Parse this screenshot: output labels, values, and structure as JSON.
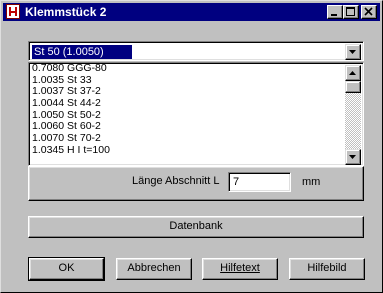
{
  "window": {
    "title": "Klemmstück 2",
    "controls": [
      "minimize-icon",
      "maximize-icon",
      "close-icon"
    ]
  },
  "combo": {
    "selected": "St 50 (1.0050)"
  },
  "list": {
    "items": [
      "0.7080 GGG-80",
      "1.0035 St 33",
      "1.0037 St 37-2",
      "1.0044 St 44-2",
      "1.0050 St 50-2",
      "1.0060 St 60-2",
      "1.0070 St 70-2",
      "1.0345 H I t=100"
    ]
  },
  "length": {
    "label": "Länge Abschnitt L",
    "value": "7",
    "unit": "mm"
  },
  "buttons": {
    "database": "Datenbank",
    "ok": "OK",
    "cancel": "Abbrechen",
    "helptext": "Hilfetext",
    "helpimage": "Hilfebild"
  }
}
